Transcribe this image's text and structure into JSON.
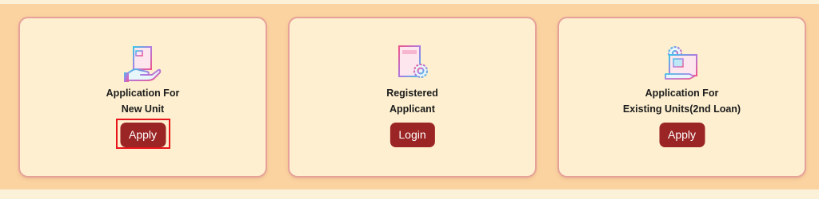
{
  "cards": [
    {
      "icon": "hand-document-icon",
      "title_line1": "Application For",
      "title_line2": "New Unit",
      "button_label": "Apply",
      "highlighted": true
    },
    {
      "icon": "document-gear-icon",
      "title_line1": "Registered",
      "title_line2": "Applicant",
      "button_label": "Login",
      "highlighted": false
    },
    {
      "icon": "blueprint-gear-icon",
      "title_line1": "Application For",
      "title_line2": "Existing Units(2nd Loan)",
      "button_label": "Apply",
      "highlighted": false
    }
  ],
  "colors": {
    "page_background": "#fbf0d8",
    "panel_background": "#fbd3a0",
    "card_background": "#fdefcf",
    "card_border": "#e6a19a",
    "button": "#9b2424",
    "highlight": "#e8141c"
  }
}
